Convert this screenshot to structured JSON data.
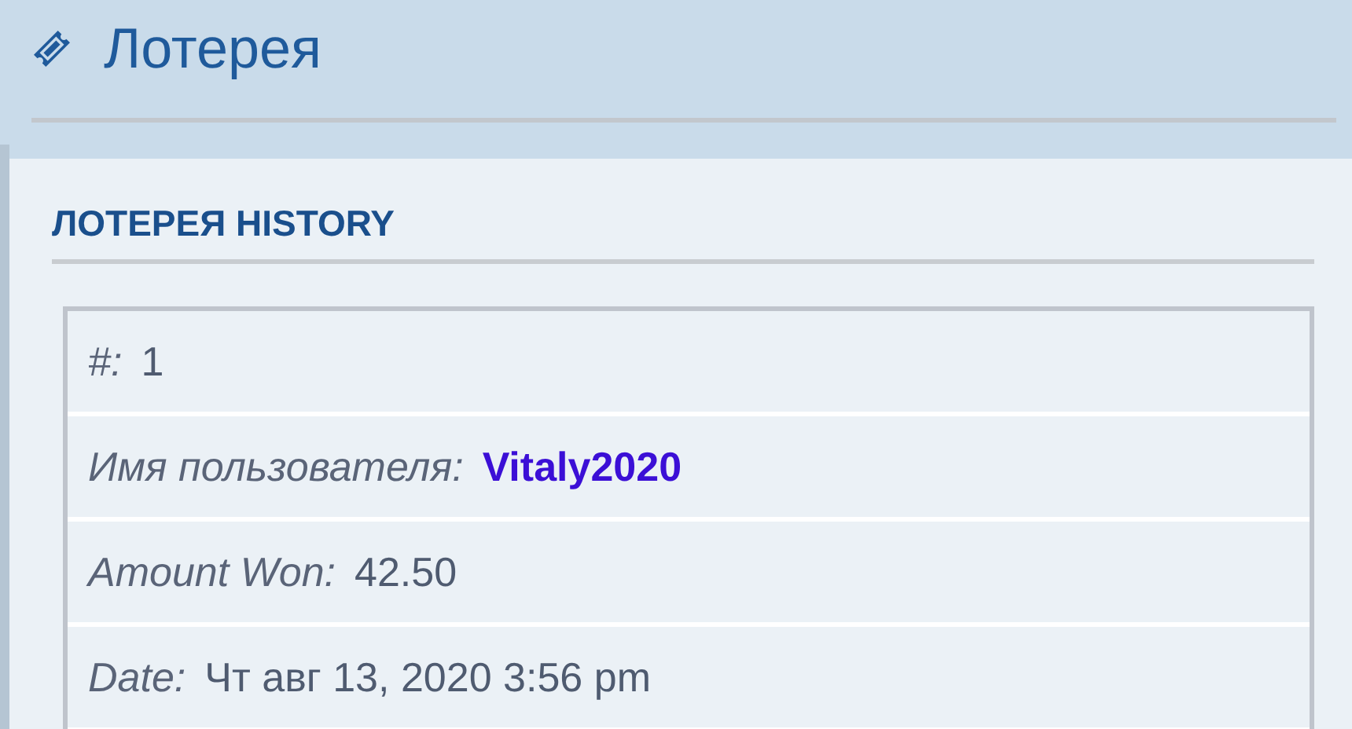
{
  "page": {
    "title": "Лотерея"
  },
  "section": {
    "title": "ЛОТЕРЕЯ HISTORY"
  },
  "rows": [
    {
      "label": "#:",
      "value": "1",
      "kind": "text"
    },
    {
      "label": "Имя пользователя:",
      "value": "Vitaly2020",
      "kind": "link"
    },
    {
      "label": "Amount Won:",
      "value": "42.50",
      "kind": "text"
    },
    {
      "label": "Date:",
      "value": "Чт авг 13, 2020 3:56 pm",
      "kind": "text"
    }
  ]
}
